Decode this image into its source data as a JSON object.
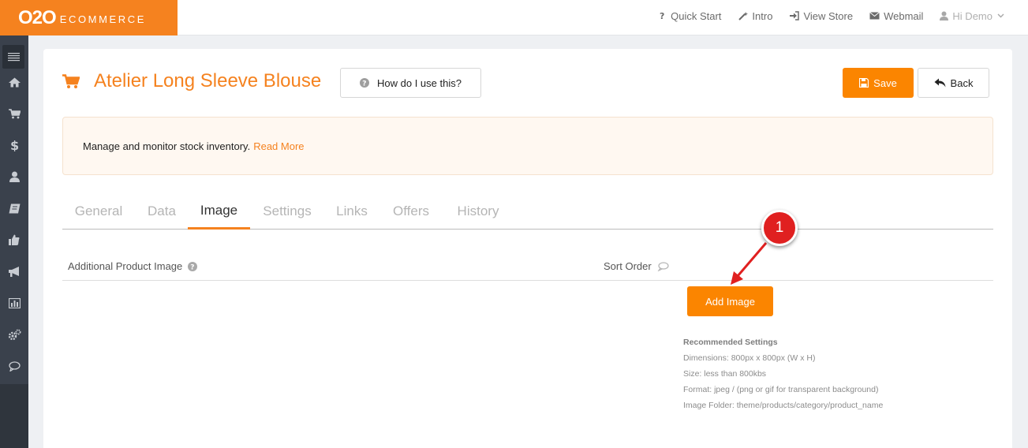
{
  "brand": {
    "logo_main": "O2O",
    "logo_sub": "ECOMMERCE"
  },
  "topnav": {
    "quick_start": "Quick Start",
    "intro": "Intro",
    "view_store": "View Store",
    "webmail": "Webmail",
    "user": "Hi Demo"
  },
  "sidebar": {
    "items": [
      "menu-icon",
      "home-icon",
      "cart-icon",
      "dollar-icon",
      "user-icon",
      "book-icon",
      "thumbs-up-icon",
      "megaphone-icon",
      "bar-chart-icon",
      "gears-icon",
      "chat-icon"
    ]
  },
  "page": {
    "title": "Atelier Long Sleeve Blouse",
    "help_label": "How do I use this?",
    "save_label": "Save",
    "back_label": "Back"
  },
  "info": {
    "text": "Manage and monitor stock inventory.",
    "link": "Read More"
  },
  "tabs": [
    "General",
    "Data",
    "Image",
    "Settings",
    "Links",
    "Offers",
    "History"
  ],
  "active_tab": "Image",
  "table": {
    "col_image": "Additional Product Image",
    "col_sort": "Sort Order"
  },
  "add_image_label": "Add Image",
  "recommended": {
    "title": "Recommended Settings",
    "dimensions": "Dimensions: 800px x 800px (W x H)",
    "size": "Size: less than 800kbs",
    "format": "Format: jpeg / (png or gif for transparent background)",
    "folder": "Image Folder: theme/products/category/product_name"
  },
  "annotation": {
    "step": "1"
  },
  "colors": {
    "accent": "#f5821f",
    "button": "#fb8500",
    "sidebar": "#3a414c",
    "marker": "#e02020"
  }
}
